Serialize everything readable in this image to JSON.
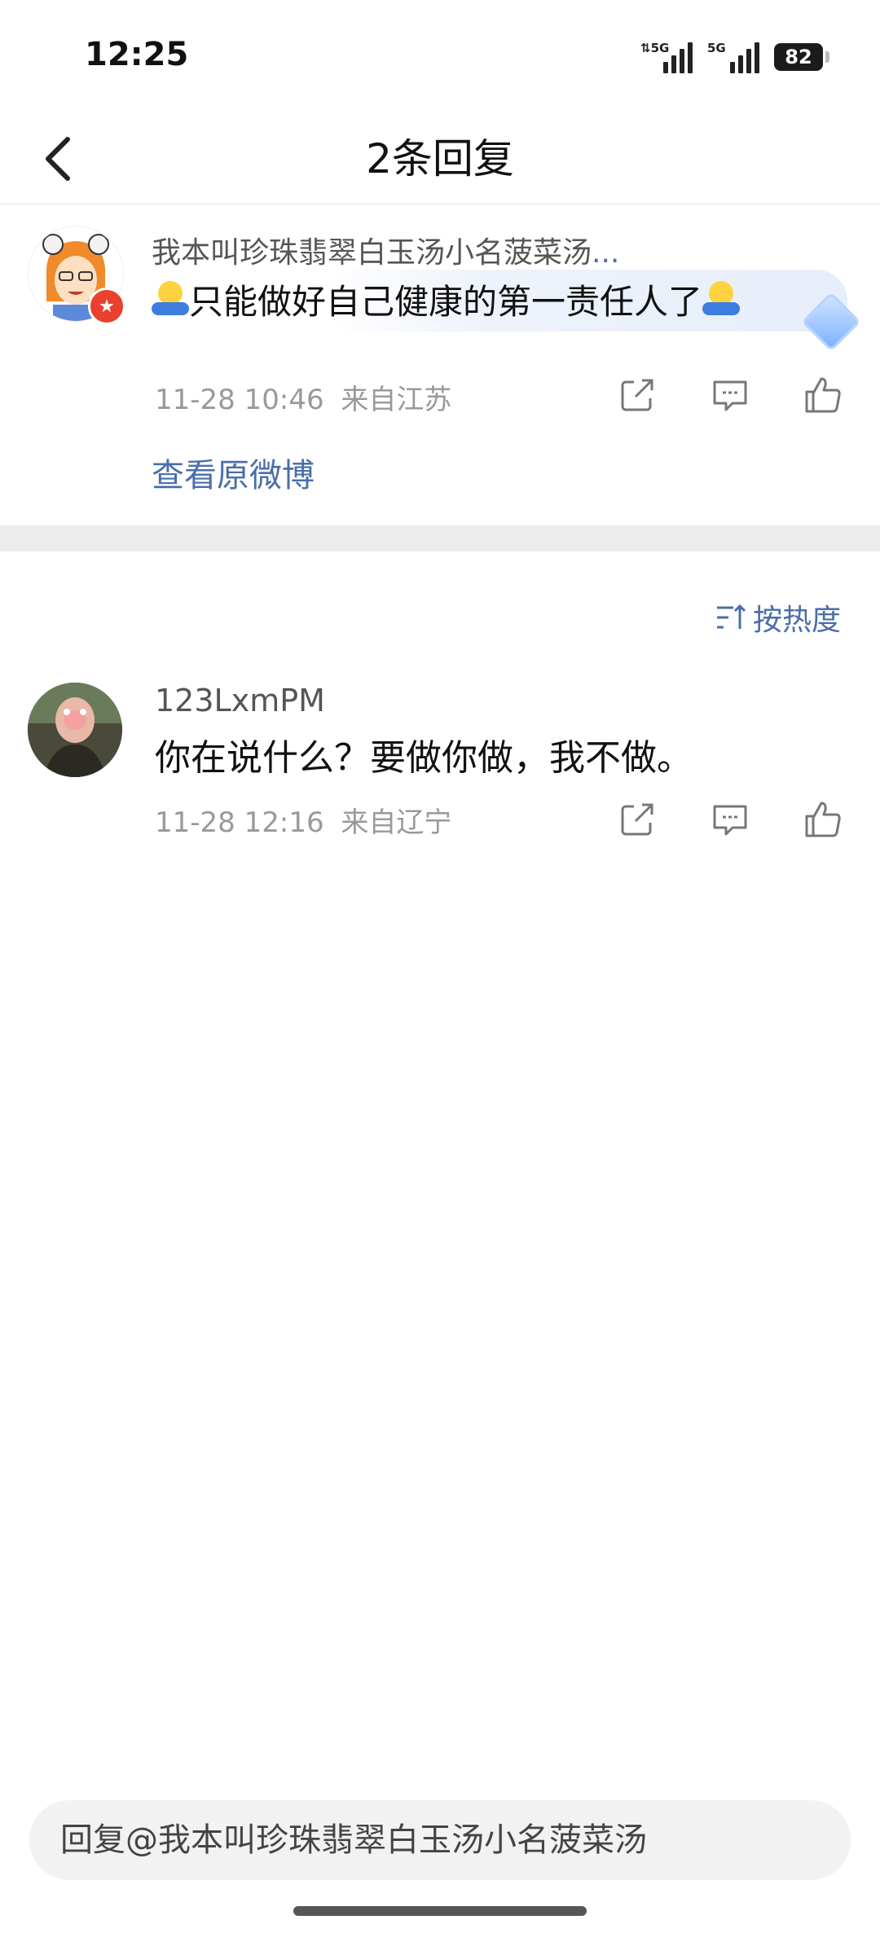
{
  "status_bar": {
    "time": "12:25",
    "signal1_tag": "⇅5G",
    "signal2_tag": "5G",
    "battery": "82"
  },
  "header": {
    "title": "2条回复"
  },
  "original_comment": {
    "username": "我本叫珍珠翡翠白玉汤小名菠菜汤",
    "username_more": "...",
    "text": "只能做好自己健康的第一责任人了",
    "datetime": "11-28 10:46",
    "location": "来自江苏",
    "view_original": "查看原微博"
  },
  "sort": {
    "label": "按热度"
  },
  "replies": [
    {
      "username": "123LxmPM",
      "text": "你在说什么？要做你做，我不做。",
      "datetime": "11-28 12:16",
      "location": "来自辽宁"
    }
  ],
  "reply_box": {
    "placeholder": "回复@我本叫珍珠翡翠白玉汤小名菠菜汤"
  },
  "colors": {
    "link": "#4a6ea9",
    "meta": "#999999",
    "divider": "#ececec",
    "input_bg": "#f2f2f2"
  }
}
